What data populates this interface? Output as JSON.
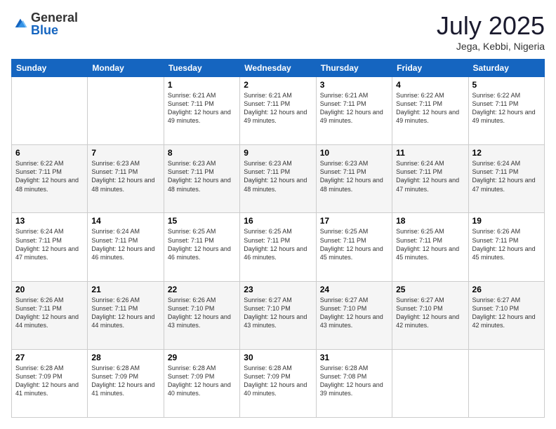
{
  "logo": {
    "general": "General",
    "blue": "Blue"
  },
  "header": {
    "month": "July 2025",
    "location": "Jega, Kebbi, Nigeria"
  },
  "weekdays": [
    "Sunday",
    "Monday",
    "Tuesday",
    "Wednesday",
    "Thursday",
    "Friday",
    "Saturday"
  ],
  "weeks": [
    [
      {
        "day": "",
        "info": ""
      },
      {
        "day": "",
        "info": ""
      },
      {
        "day": "1",
        "info": "Sunrise: 6:21 AM\nSunset: 7:11 PM\nDaylight: 12 hours and 49 minutes."
      },
      {
        "day": "2",
        "info": "Sunrise: 6:21 AM\nSunset: 7:11 PM\nDaylight: 12 hours and 49 minutes."
      },
      {
        "day": "3",
        "info": "Sunrise: 6:21 AM\nSunset: 7:11 PM\nDaylight: 12 hours and 49 minutes."
      },
      {
        "day": "4",
        "info": "Sunrise: 6:22 AM\nSunset: 7:11 PM\nDaylight: 12 hours and 49 minutes."
      },
      {
        "day": "5",
        "info": "Sunrise: 6:22 AM\nSunset: 7:11 PM\nDaylight: 12 hours and 49 minutes."
      }
    ],
    [
      {
        "day": "6",
        "info": "Sunrise: 6:22 AM\nSunset: 7:11 PM\nDaylight: 12 hours and 48 minutes."
      },
      {
        "day": "7",
        "info": "Sunrise: 6:23 AM\nSunset: 7:11 PM\nDaylight: 12 hours and 48 minutes."
      },
      {
        "day": "8",
        "info": "Sunrise: 6:23 AM\nSunset: 7:11 PM\nDaylight: 12 hours and 48 minutes."
      },
      {
        "day": "9",
        "info": "Sunrise: 6:23 AM\nSunset: 7:11 PM\nDaylight: 12 hours and 48 minutes."
      },
      {
        "day": "10",
        "info": "Sunrise: 6:23 AM\nSunset: 7:11 PM\nDaylight: 12 hours and 48 minutes."
      },
      {
        "day": "11",
        "info": "Sunrise: 6:24 AM\nSunset: 7:11 PM\nDaylight: 12 hours and 47 minutes."
      },
      {
        "day": "12",
        "info": "Sunrise: 6:24 AM\nSunset: 7:11 PM\nDaylight: 12 hours and 47 minutes."
      }
    ],
    [
      {
        "day": "13",
        "info": "Sunrise: 6:24 AM\nSunset: 7:11 PM\nDaylight: 12 hours and 47 minutes."
      },
      {
        "day": "14",
        "info": "Sunrise: 6:24 AM\nSunset: 7:11 PM\nDaylight: 12 hours and 46 minutes."
      },
      {
        "day": "15",
        "info": "Sunrise: 6:25 AM\nSunset: 7:11 PM\nDaylight: 12 hours and 46 minutes."
      },
      {
        "day": "16",
        "info": "Sunrise: 6:25 AM\nSunset: 7:11 PM\nDaylight: 12 hours and 46 minutes."
      },
      {
        "day": "17",
        "info": "Sunrise: 6:25 AM\nSunset: 7:11 PM\nDaylight: 12 hours and 45 minutes."
      },
      {
        "day": "18",
        "info": "Sunrise: 6:25 AM\nSunset: 7:11 PM\nDaylight: 12 hours and 45 minutes."
      },
      {
        "day": "19",
        "info": "Sunrise: 6:26 AM\nSunset: 7:11 PM\nDaylight: 12 hours and 45 minutes."
      }
    ],
    [
      {
        "day": "20",
        "info": "Sunrise: 6:26 AM\nSunset: 7:11 PM\nDaylight: 12 hours and 44 minutes."
      },
      {
        "day": "21",
        "info": "Sunrise: 6:26 AM\nSunset: 7:11 PM\nDaylight: 12 hours and 44 minutes."
      },
      {
        "day": "22",
        "info": "Sunrise: 6:26 AM\nSunset: 7:10 PM\nDaylight: 12 hours and 43 minutes."
      },
      {
        "day": "23",
        "info": "Sunrise: 6:27 AM\nSunset: 7:10 PM\nDaylight: 12 hours and 43 minutes."
      },
      {
        "day": "24",
        "info": "Sunrise: 6:27 AM\nSunset: 7:10 PM\nDaylight: 12 hours and 43 minutes."
      },
      {
        "day": "25",
        "info": "Sunrise: 6:27 AM\nSunset: 7:10 PM\nDaylight: 12 hours and 42 minutes."
      },
      {
        "day": "26",
        "info": "Sunrise: 6:27 AM\nSunset: 7:10 PM\nDaylight: 12 hours and 42 minutes."
      }
    ],
    [
      {
        "day": "27",
        "info": "Sunrise: 6:28 AM\nSunset: 7:09 PM\nDaylight: 12 hours and 41 minutes."
      },
      {
        "day": "28",
        "info": "Sunrise: 6:28 AM\nSunset: 7:09 PM\nDaylight: 12 hours and 41 minutes."
      },
      {
        "day": "29",
        "info": "Sunrise: 6:28 AM\nSunset: 7:09 PM\nDaylight: 12 hours and 40 minutes."
      },
      {
        "day": "30",
        "info": "Sunrise: 6:28 AM\nSunset: 7:09 PM\nDaylight: 12 hours and 40 minutes."
      },
      {
        "day": "31",
        "info": "Sunrise: 6:28 AM\nSunset: 7:08 PM\nDaylight: 12 hours and 39 minutes."
      },
      {
        "day": "",
        "info": ""
      },
      {
        "day": "",
        "info": ""
      }
    ]
  ]
}
